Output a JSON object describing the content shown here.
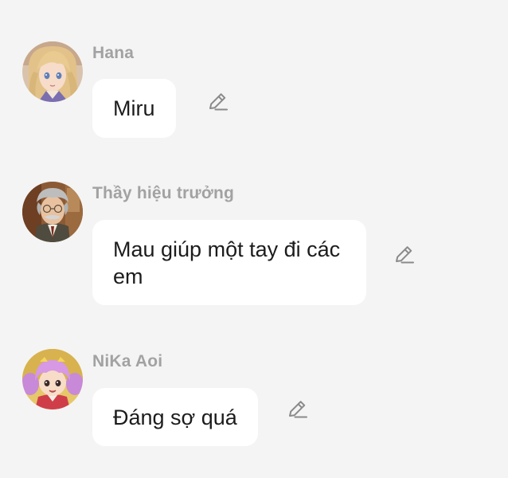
{
  "messages": [
    {
      "sender": "Hana",
      "text": "Miru",
      "avatar_icon": "blonde-girl-avatar"
    },
    {
      "sender": "Thầy hiệu trưởng",
      "text": "Mau giúp một tay đi các em",
      "avatar_icon": "old-principal-avatar"
    },
    {
      "sender": "NiKa Aoi",
      "text": "Đáng sợ quá",
      "avatar_icon": "pink-hair-girl-avatar"
    }
  ],
  "edit_icon": "pencil-edit-icon",
  "colors": {
    "background": "#f4f4f4",
    "bubble": "#ffffff",
    "sender_name": "#a2a2a2",
    "message_text": "#1c1c1c",
    "edit_icon": "#8a8a8a"
  }
}
